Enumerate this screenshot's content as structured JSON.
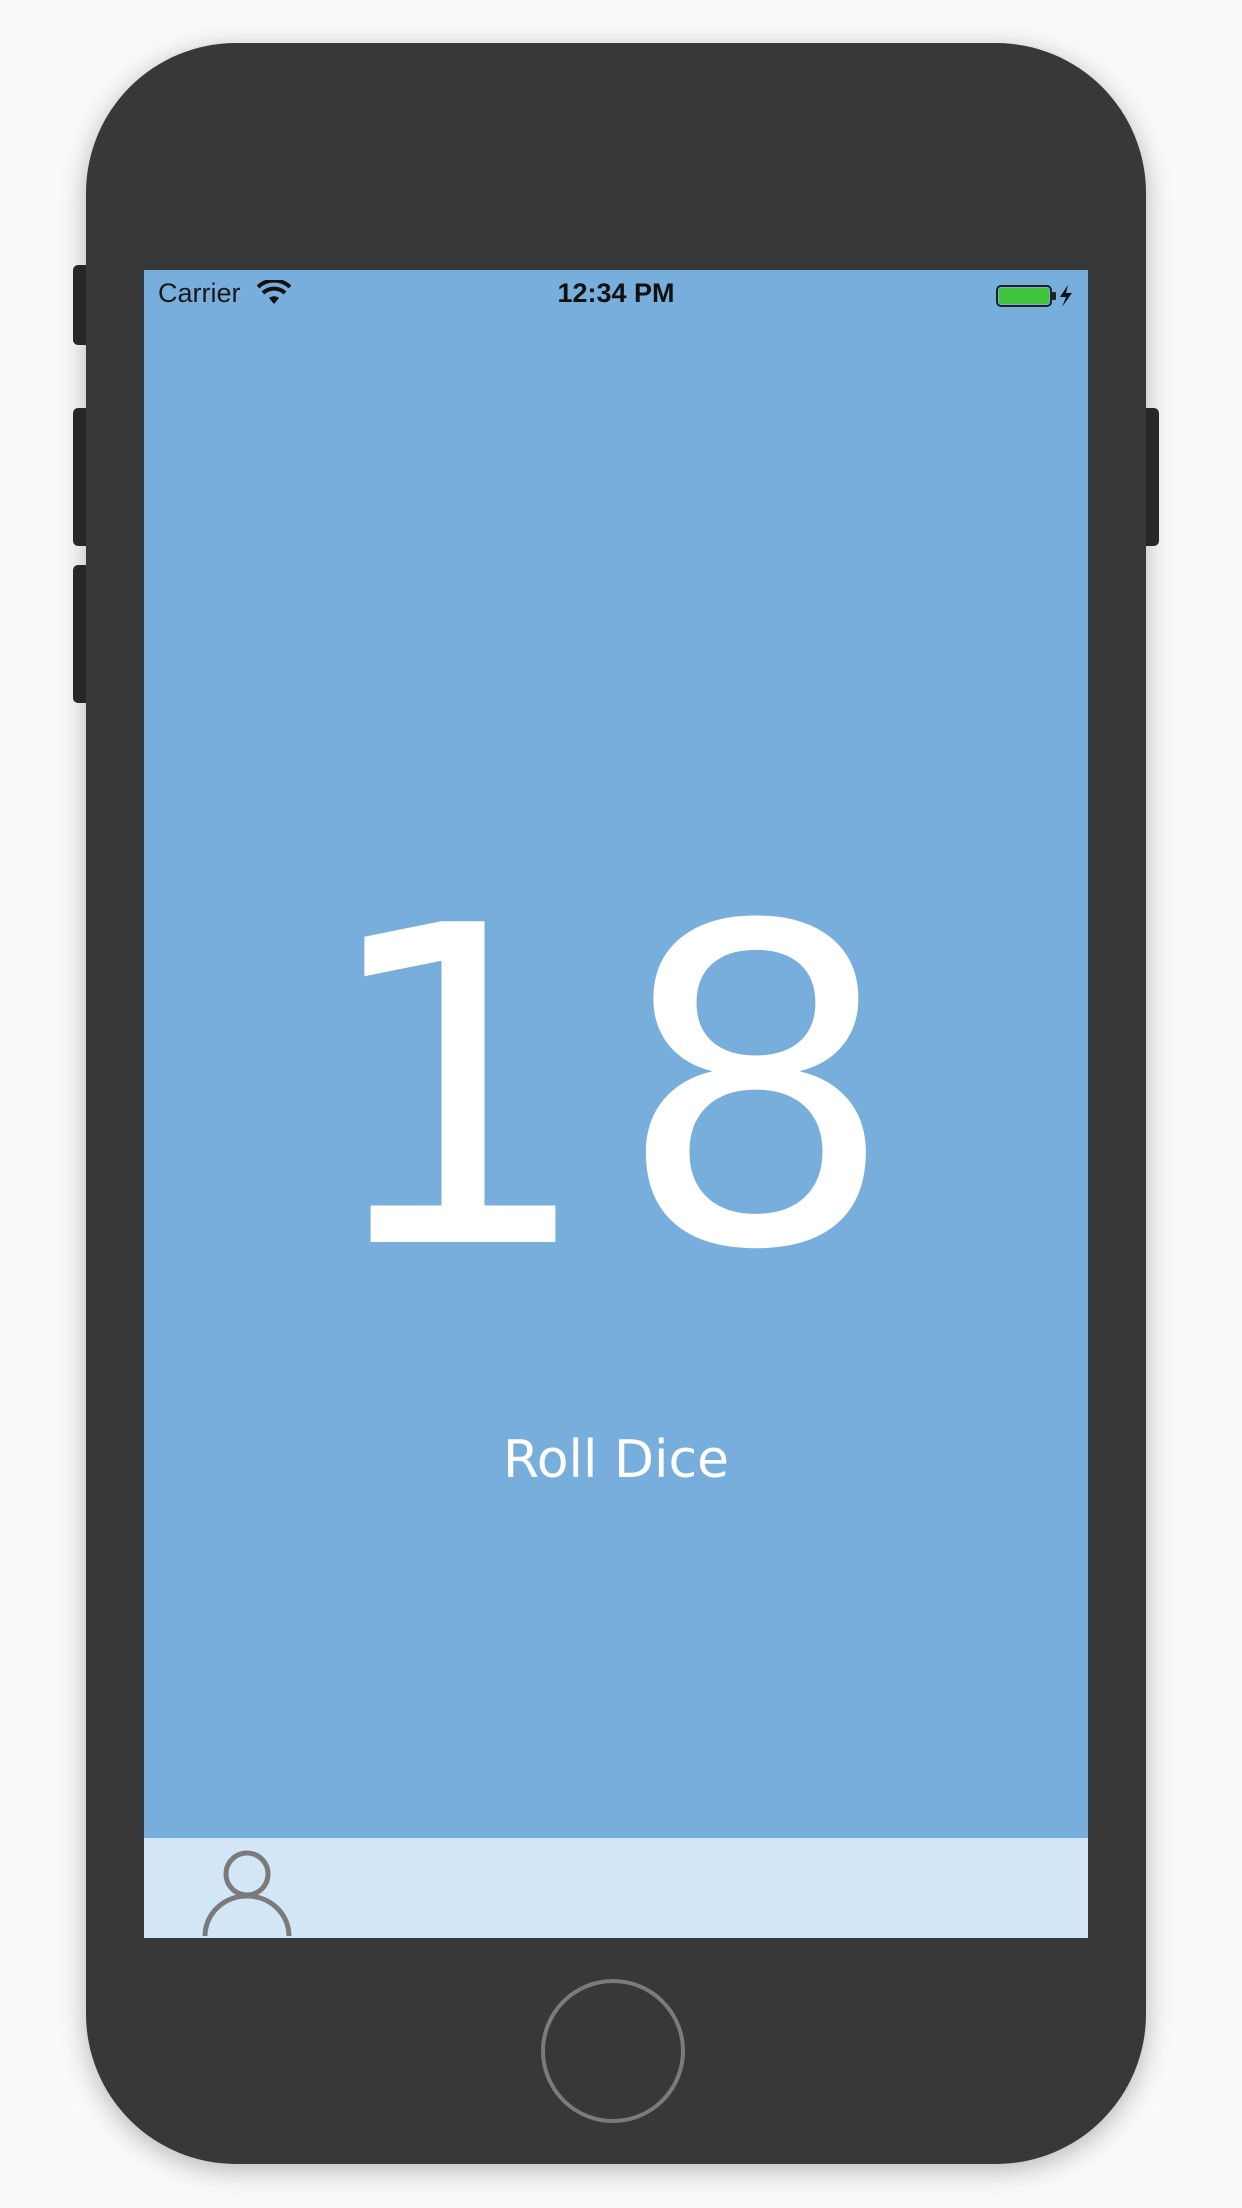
{
  "status_bar": {
    "carrier": "Carrier",
    "time": "12:34 PM",
    "wifi_icon": "wifi-icon",
    "battery_icon": "battery-charging-icon",
    "battery_level": 1.0,
    "battery_color": "#3ec43a"
  },
  "main": {
    "dice_total": "18",
    "roll_button_label": "Roll Dice"
  },
  "tab_bar": {
    "profile_icon": "person-icon"
  },
  "colors": {
    "screen_background": "#77aedb",
    "tab_bar_background": "#d3e6f6",
    "phone_body": "#383838",
    "text_primary": "#ffffff"
  }
}
